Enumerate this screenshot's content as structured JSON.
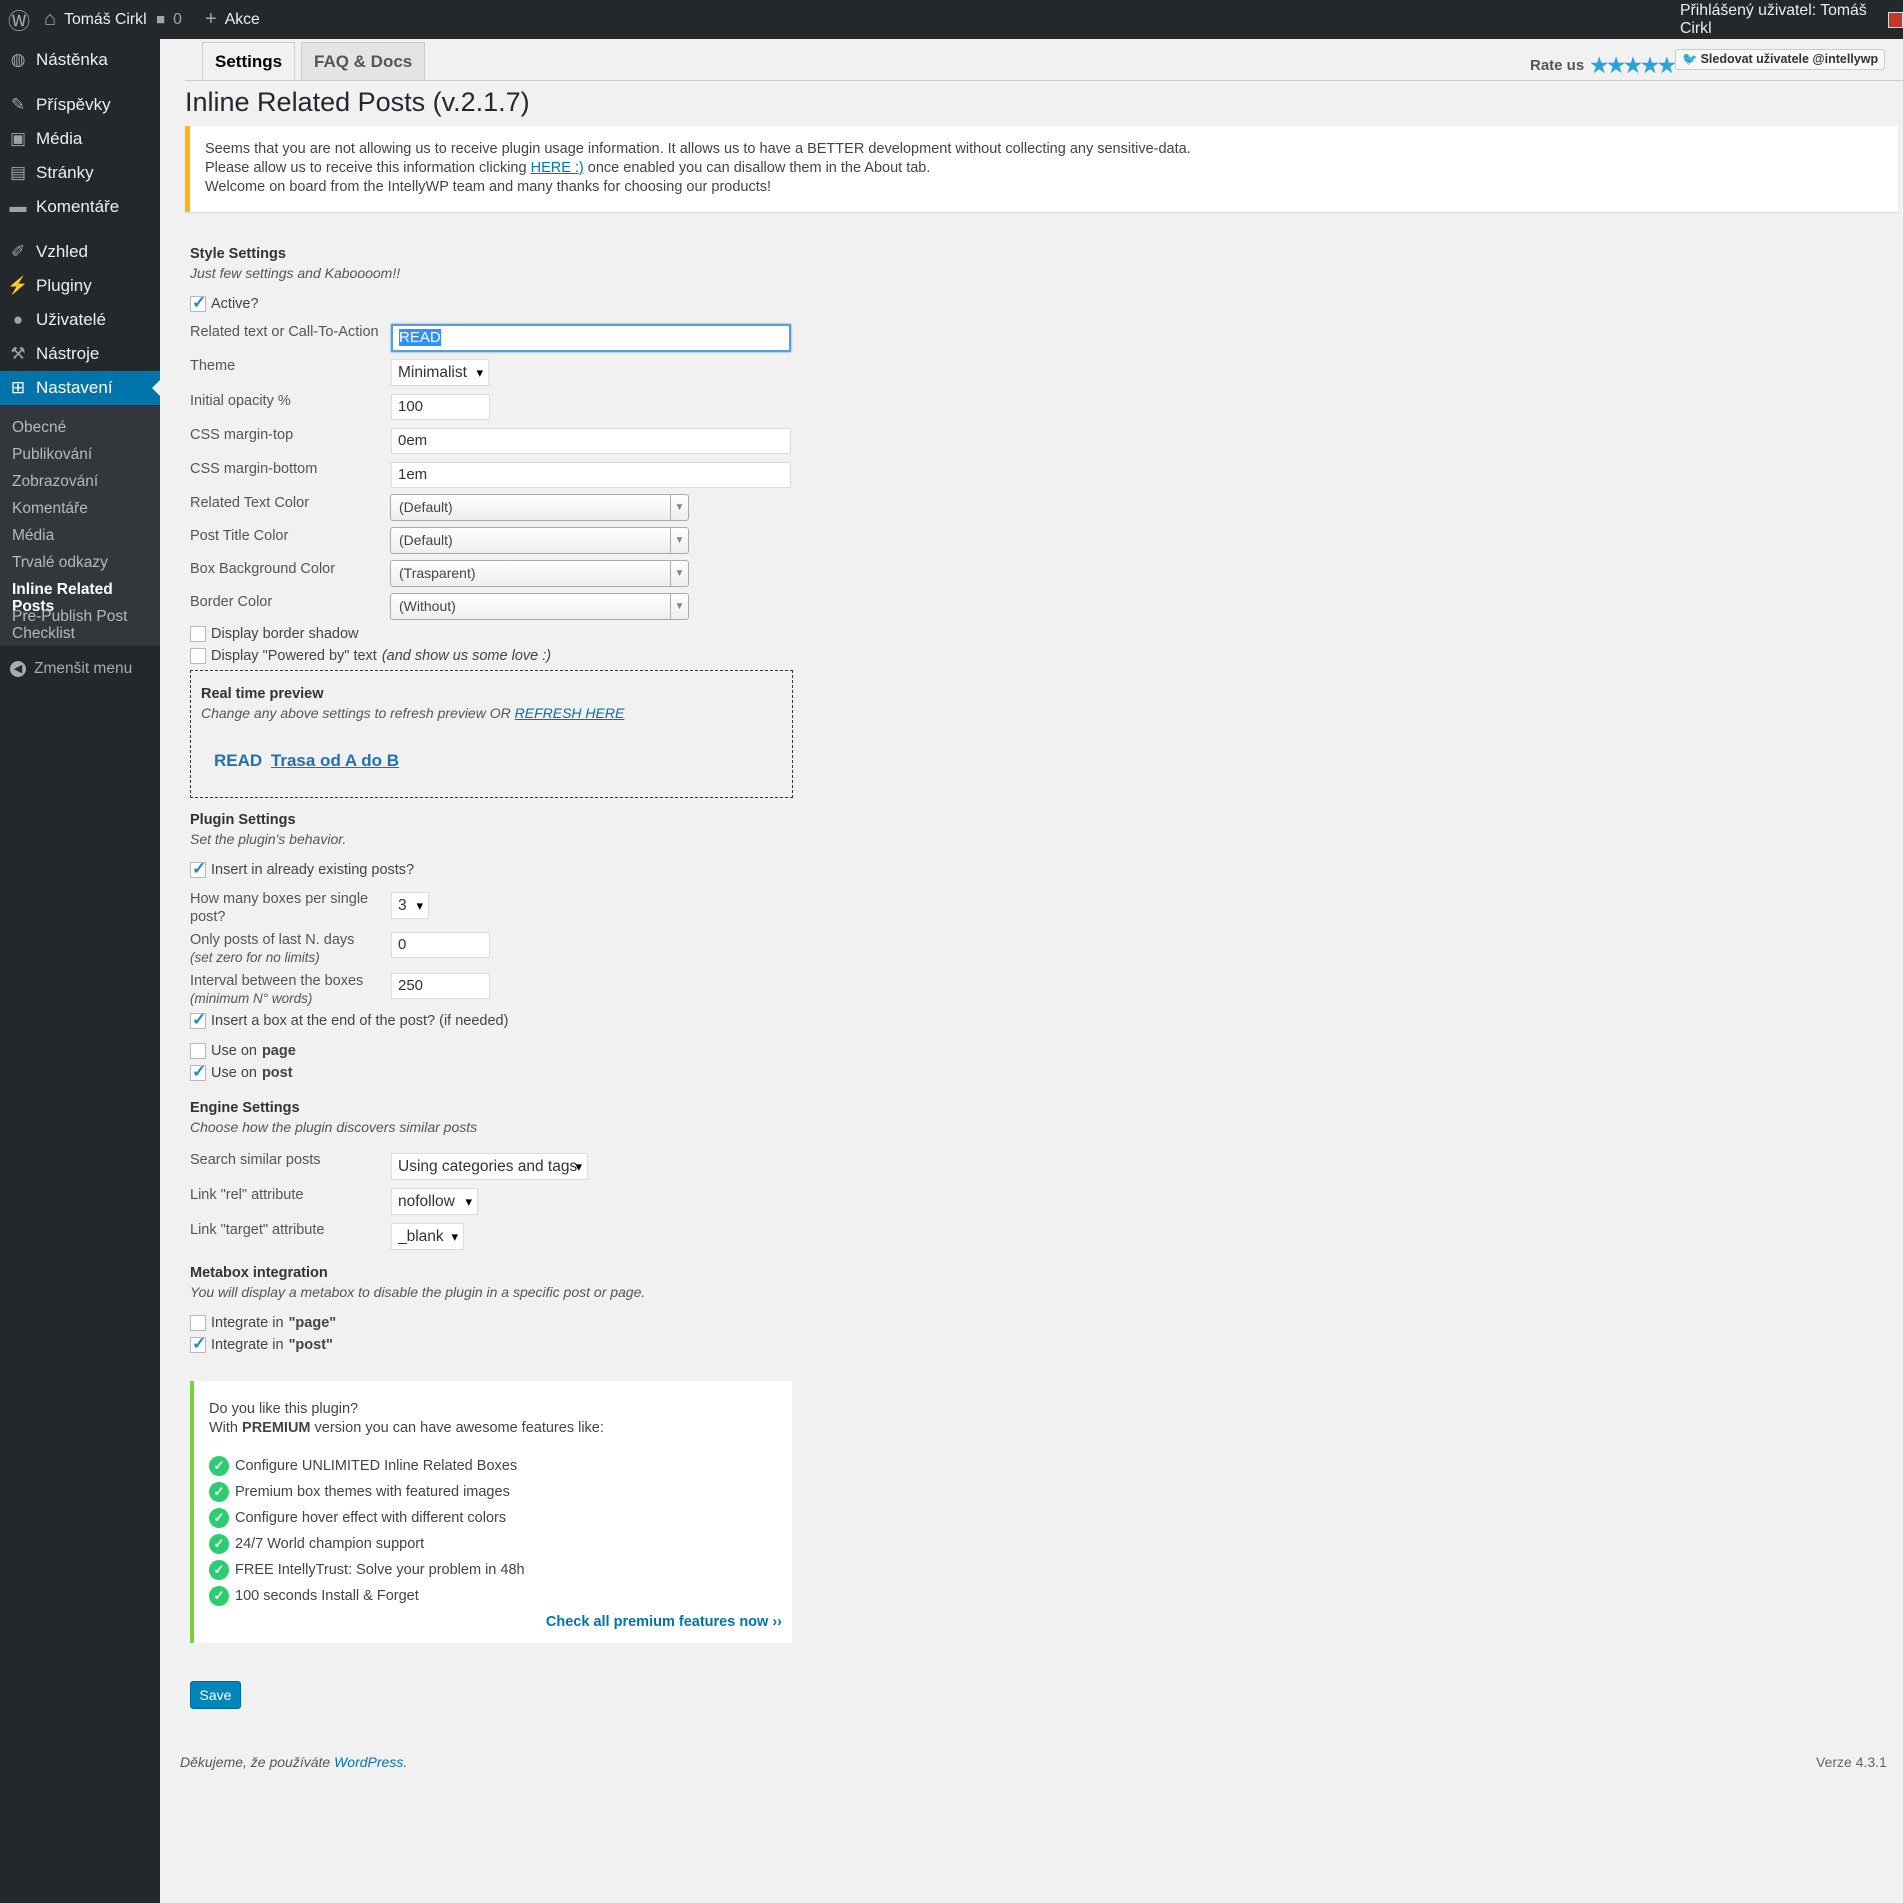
{
  "adminbar": {
    "site_name": "Tomáš Cirkl",
    "comments_count": "0",
    "new_label": "Akce",
    "user_label": "Přihlášený uživatel: Tomáš Cirkl"
  },
  "sidebar": {
    "items": [
      {
        "label": "Nástěnka",
        "icon": "dashboard-icon"
      },
      {
        "label": "Příspěvky",
        "icon": "pin-icon"
      },
      {
        "label": "Média",
        "icon": "media-icon"
      },
      {
        "label": "Stránky",
        "icon": "pages-icon"
      },
      {
        "label": "Komentáře",
        "icon": "comments-icon"
      },
      {
        "label": "Vzhled",
        "icon": "brush-icon"
      },
      {
        "label": "Pluginy",
        "icon": "plugin-icon"
      },
      {
        "label": "Uživatelé",
        "icon": "users-icon"
      },
      {
        "label": "Nástroje",
        "icon": "wrench-icon"
      },
      {
        "label": "Nastavení",
        "icon": "settings-icon"
      }
    ],
    "submenu": [
      "Obecné",
      "Publikování",
      "Zobrazování",
      "Komentáře",
      "Média",
      "Trvalé odkazy",
      "Inline Related Posts",
      "Pre-Publish Post Checklist"
    ],
    "collapse_label": "Zmenšit menu"
  },
  "tabs": {
    "settings": "Settings",
    "faq": "FAQ & Docs"
  },
  "rate_label": "Rate us",
  "stars": "★★★★★",
  "twitter_label": "Sledovat uživatele @intellywp",
  "page_title": "Inline Related Posts (v.2.1.7)",
  "notice": {
    "line1": "Seems that you are not allowing us to receive plugin usage information. It allows us to have a BETTER development without collecting any sensitive-data.",
    "line2_pre": "Please allow us to receive this information clicking ",
    "line2_link": "HERE :)",
    "line2_post": " once enabled you can disallow them in the About tab.",
    "line3": "Welcome on board from the IntellyWP team and many thanks for choosing our products!"
  },
  "style": {
    "heading": "Style Settings",
    "desc": "Just few settings and Kaboooom!!",
    "active_label": "Active?",
    "related_text_label": "Related text or Call-To-Action",
    "related_text_value": "READ",
    "theme_label": "Theme",
    "theme_value": "Minimalist",
    "opacity_label": "Initial opacity %",
    "opacity_value": "100",
    "margin_top_label": "CSS margin-top",
    "margin_top_value": "0em",
    "margin_bottom_label": "CSS margin-bottom",
    "margin_bottom_value": "1em",
    "related_color_label": "Related Text Color",
    "related_color_value": "(Default)",
    "post_title_color_label": "Post Title Color",
    "post_title_color_value": "(Default)",
    "box_bg_label": "Box Background Color",
    "box_bg_value": "(Trasparent)",
    "border_color_label": "Border Color",
    "border_color_value": "(Without)",
    "shadow_label": "Display border shadow",
    "powered_label": "Display \"Powered by\" text",
    "powered_note": "(and show us some love :)"
  },
  "preview": {
    "title": "Real time preview",
    "desc": "Change any above settings to refresh preview OR ",
    "refresh_link": "REFRESH HERE",
    "cta": "READ",
    "post_title": "Trasa od A do B"
  },
  "plugin": {
    "heading": "Plugin Settings",
    "desc": "Set the plugin's behavior.",
    "insert_existing_label": "Insert in already existing posts?",
    "boxes_label_1": "How many boxes per single",
    "boxes_label_2": "post?",
    "boxes_value": "3",
    "days_label": "Only posts of last N. days",
    "days_note": "(set zero for no limits)",
    "days_value": "0",
    "interval_label": "Interval between the boxes",
    "interval_note": "(minimum N° words)",
    "interval_value": "250",
    "end_box_label": "Insert a box at the end of the post? (if needed)",
    "use_label": "Use on",
    "use_page": "page",
    "use_post": "post"
  },
  "engine": {
    "heading": "Engine Settings",
    "desc": "Choose how the plugin discovers similar posts",
    "search_label": "Search similar posts",
    "search_value": "Using categories and tags",
    "rel_label": "Link \"rel\" attribute",
    "rel_value": "nofollow",
    "target_label": "Link \"target\" attribute",
    "target_value": "_blank"
  },
  "metabox": {
    "heading": "Metabox integration",
    "desc": "You will display a metabox to disable the plugin in a specific post or page.",
    "integrate_label": "Integrate in",
    "page": "\"page\"",
    "post": "\"post\""
  },
  "premium": {
    "line1": "Do you like this plugin?",
    "line2_pre": "With ",
    "line2_bold": "PREMIUM",
    "line2_post": " version you can have awesome features like:",
    "features": [
      "Configure UNLIMITED Inline Related Boxes",
      "Premium box themes with featured images",
      "Configure hover effect with different colors",
      "24/7 World champion support",
      "FREE IntellyTrust: Solve your problem in 48h",
      "100 seconds Install & Forget"
    ],
    "cta": "Check all premium features now ››"
  },
  "save_label": "Save",
  "footer": {
    "thanks_pre": "Děkujeme, že používáte ",
    "thanks_link": "WordPress",
    "thanks_post": ".",
    "version": "Verze 4.3.1"
  },
  "colors": {
    "accent": "#0073aa",
    "sidebar": "#23282d",
    "notice": "#ffb900",
    "premium_border": "#7ad03a",
    "check": "#2ecc71"
  }
}
